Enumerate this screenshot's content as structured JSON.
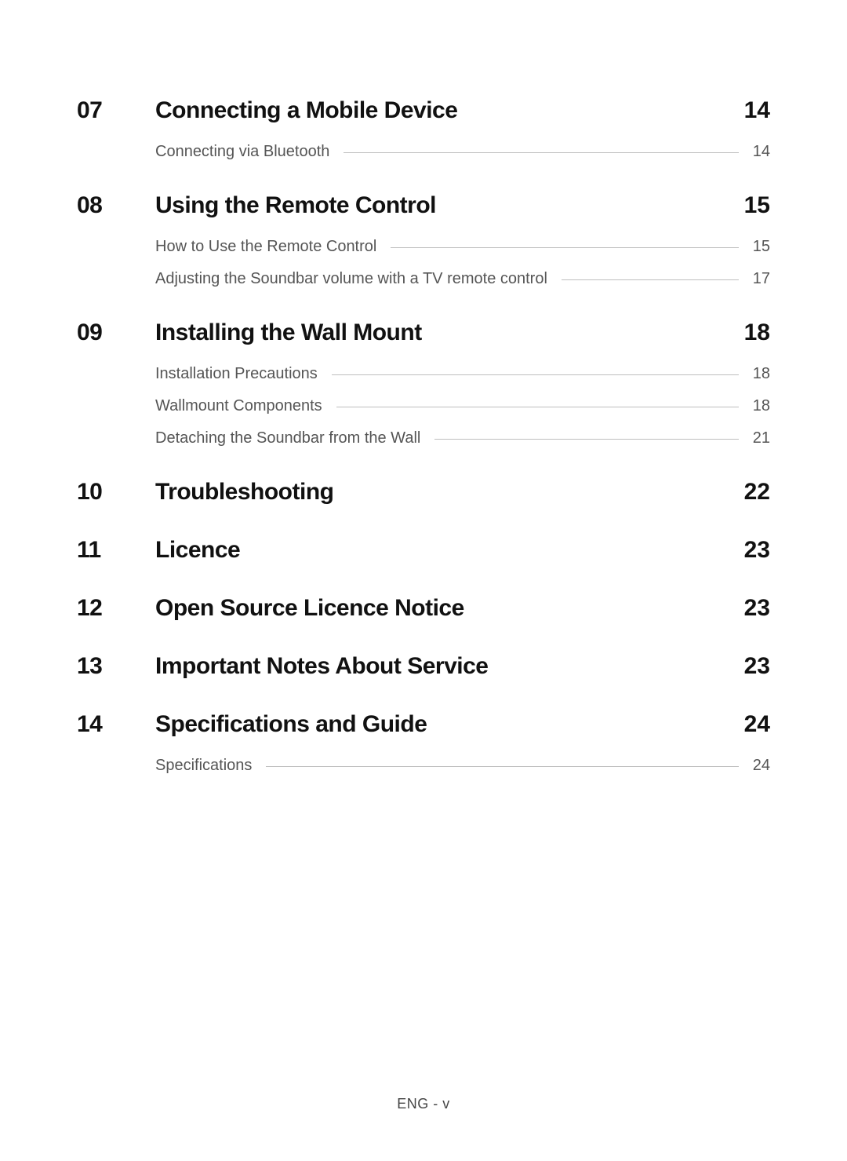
{
  "toc": {
    "sections": [
      {
        "num": "07",
        "title": "Connecting a Mobile Device",
        "page": "14",
        "subs": [
          {
            "title": "Connecting via Bluetooth",
            "page": "14"
          }
        ]
      },
      {
        "num": "08",
        "title": "Using the Remote Control",
        "page": "15",
        "subs": [
          {
            "title": "How to Use the Remote Control",
            "page": "15"
          },
          {
            "title": "Adjusting the Soundbar volume with a TV remote control",
            "page": "17"
          }
        ]
      },
      {
        "num": "09",
        "title": "Installing the Wall Mount",
        "page": "18",
        "subs": [
          {
            "title": "Installation Precautions",
            "page": "18"
          },
          {
            "title": "Wallmount Components",
            "page": "18"
          },
          {
            "title": "Detaching the Soundbar from the Wall",
            "page": "21"
          }
        ]
      },
      {
        "num": "10",
        "title": "Troubleshooting",
        "page": "22",
        "subs": []
      },
      {
        "num": "11",
        "title": "Licence",
        "page": "23",
        "subs": []
      },
      {
        "num": "12",
        "title": "Open Source Licence Notice",
        "page": "23",
        "subs": []
      },
      {
        "num": "13",
        "title": "Important Notes About Service",
        "page": "23",
        "subs": []
      },
      {
        "num": "14",
        "title": "Specifications and Guide",
        "page": "24",
        "subs": [
          {
            "title": "Specifications",
            "page": "24"
          }
        ]
      }
    ]
  },
  "footer": "ENG - v"
}
